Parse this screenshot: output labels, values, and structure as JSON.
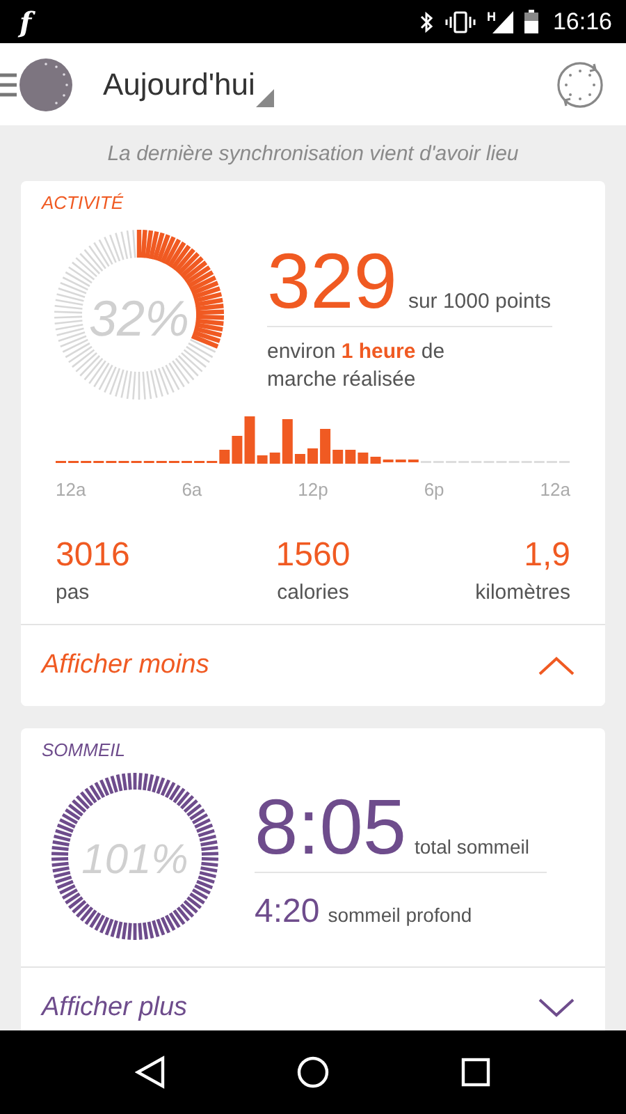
{
  "status_bar": {
    "app_icon": "f",
    "network_type": "H",
    "time": "16:16"
  },
  "app_bar": {
    "title": "Aujourd'hui"
  },
  "sync_banner": "La dernière synchronisation vient d'avoir lieu",
  "activity": {
    "title": "ACTIVITÉ",
    "percent": "32%",
    "points": "329",
    "points_caption": "sur 1000 points",
    "walk_note": "environ **1 heure** de marche réalisée",
    "chart_axis": [
      "12a",
      "6a",
      "12p",
      "6p",
      "12a"
    ],
    "stats": [
      {
        "value": "3016",
        "label": "pas"
      },
      {
        "value": "1560",
        "label": "calories"
      },
      {
        "value": "1,9",
        "label": "kilomètres"
      }
    ],
    "toggle": {
      "label": "Afficher moins",
      "expanded": true
    }
  },
  "sleep": {
    "title": "SOMMEIL",
    "percent": "101%",
    "total": "8:05",
    "total_caption": "total sommeil",
    "deep": "4:20",
    "deep_caption": "sommeil profond",
    "toggle": {
      "label": "Afficher plus",
      "expanded": false
    }
  }
}
